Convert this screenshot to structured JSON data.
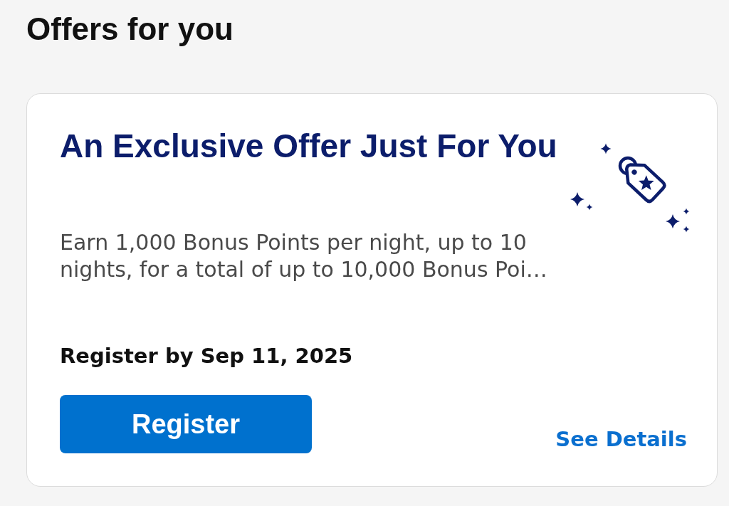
{
  "page": {
    "title": "Offers for you"
  },
  "offers": [
    {
      "title": "An Exclusive Offer Just For You",
      "description": "Earn 1,000 Bonus Points per night, up to 10 nights, for a total of up to 10,000 Bonus Poi…",
      "deadline": "Register by Sep 11, 2025",
      "primary_button": "Register",
      "link": "See Details"
    }
  ]
}
